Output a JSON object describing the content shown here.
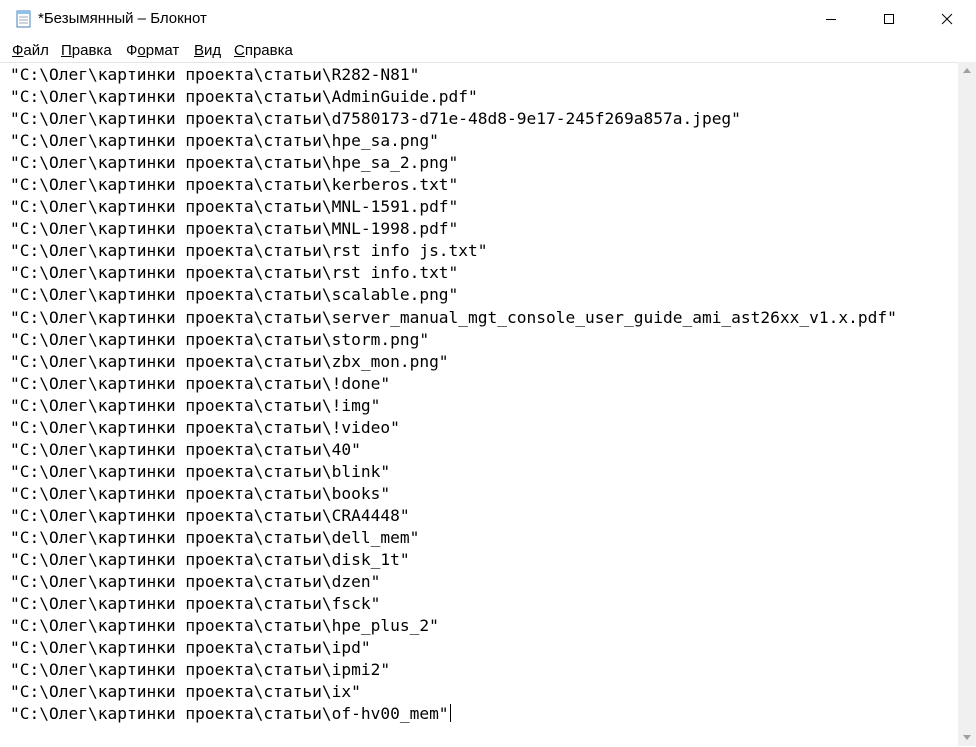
{
  "window": {
    "title": "*Безымянный – Блокнот",
    "app_icon": "notepad-icon",
    "controls": {
      "minimize_icon": "minimize-icon",
      "maximize_icon": "maximize-icon",
      "close_icon": "close-icon"
    }
  },
  "menu": {
    "items": [
      {
        "hotkey": "Ф",
        "rest": "айл"
      },
      {
        "hotkey": "П",
        "rest": "равка"
      },
      {
        "hotkey": "о",
        "pre": "Ф",
        "rest": "рмат"
      },
      {
        "hotkey": "В",
        "rest": "ид"
      },
      {
        "hotkey": "С",
        "rest": "правка"
      }
    ]
  },
  "editor": {
    "lines": [
      "\"C:\\Олег\\картинки проекта\\статьи\\R282-N81\"",
      "\"C:\\Олег\\картинки проекта\\статьи\\AdminGuide.pdf\"",
      "\"C:\\Олег\\картинки проекта\\статьи\\d7580173-d71e-48d8-9e17-245f269a857a.jpeg\"",
      "\"C:\\Олег\\картинки проекта\\статьи\\hpe_sa.png\"",
      "\"C:\\Олег\\картинки проекта\\статьи\\hpe_sa_2.png\"",
      "\"C:\\Олег\\картинки проекта\\статьи\\kerberos.txt\"",
      "\"C:\\Олег\\картинки проекта\\статьи\\MNL-1591.pdf\"",
      "\"C:\\Олег\\картинки проекта\\статьи\\MNL-1998.pdf\"",
      "\"C:\\Олег\\картинки проекта\\статьи\\rst info js.txt\"",
      "\"C:\\Олег\\картинки проекта\\статьи\\rst info.txt\"",
      "\"C:\\Олег\\картинки проекта\\статьи\\scalable.png\"",
      "\"C:\\Олег\\картинки проекта\\статьи\\server_manual_mgt_console_user_guide_ami_ast26xx_v1.x.pdf\"",
      "\"C:\\Олег\\картинки проекта\\статьи\\storm.png\"",
      "\"C:\\Олег\\картинки проекта\\статьи\\zbx_mon.png\"",
      "\"C:\\Олег\\картинки проекта\\статьи\\!done\"",
      "\"C:\\Олег\\картинки проекта\\статьи\\!img\"",
      "\"C:\\Олег\\картинки проекта\\статьи\\!video\"",
      "\"C:\\Олег\\картинки проекта\\статьи\\40\"",
      "\"C:\\Олег\\картинки проекта\\статьи\\blink\"",
      "\"C:\\Олег\\картинки проекта\\статьи\\books\"",
      "\"C:\\Олег\\картинки проекта\\статьи\\CRA4448\"",
      "\"C:\\Олег\\картинки проекта\\статьи\\dell_mem\"",
      "\"C:\\Олег\\картинки проекта\\статьи\\disk_1t\"",
      "\"C:\\Олег\\картинки проекта\\статьи\\dzen\"",
      "\"C:\\Олег\\картинки проекта\\статьи\\fsck\"",
      "\"C:\\Олег\\картинки проекта\\статьи\\hpe_plus_2\"",
      "\"C:\\Олег\\картинки проекта\\статьи\\ipd\"",
      "\"C:\\Олег\\картинки проекта\\статьи\\ipmi2\"",
      "\"C:\\Олег\\картинки проекта\\статьи\\ix\"",
      "\"C:\\Олег\\картинки проекта\\статьи\\of-hv00_mem\""
    ]
  },
  "scrollbar": {
    "up_icon": "scroll-up-arrow-icon",
    "down_icon": "scroll-down-arrow-icon"
  }
}
